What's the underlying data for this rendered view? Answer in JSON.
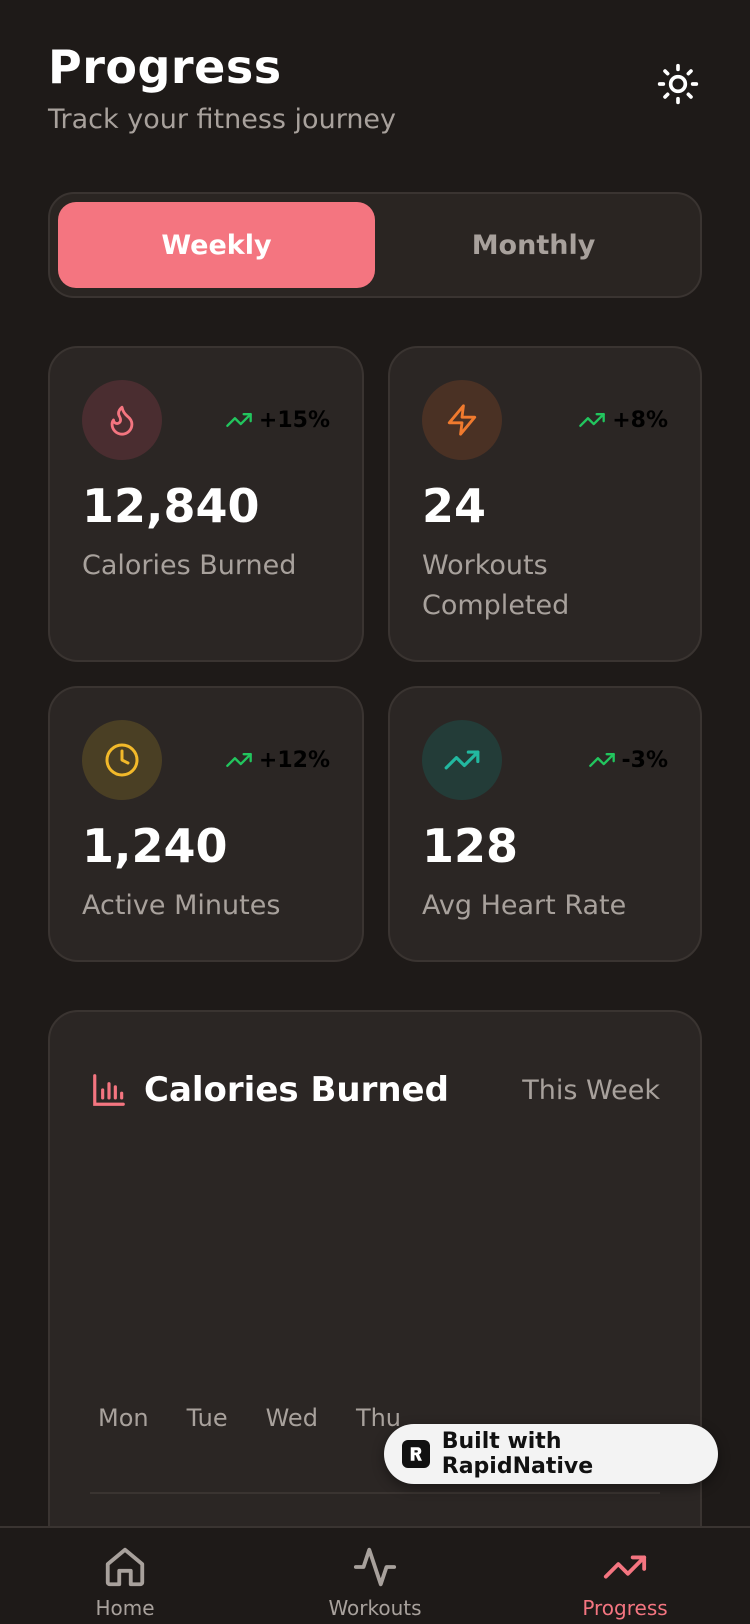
{
  "header": {
    "title": "Progress",
    "subtitle": "Track your fitness journey"
  },
  "segment": {
    "weekly": "Weekly",
    "monthly": "Monthly",
    "selected": "Weekly"
  },
  "stats": [
    {
      "icon": "flame-icon",
      "trend": "+15%",
      "value": "12,840",
      "label": "Calories Burned",
      "accent": "#f47580",
      "bg": "#4a2d30"
    },
    {
      "icon": "lightning-icon",
      "trend": "+8%",
      "value": "24",
      "label": "Workouts Completed",
      "accent": "#f07a2e",
      "bg": "#4a3124"
    },
    {
      "icon": "clock-icon",
      "trend": "+12%",
      "value": "1,240",
      "label": "Active Minutes",
      "accent": "#f2b92a",
      "bg": "#4a3f24"
    },
    {
      "icon": "trending-up-icon",
      "trend": "-3%",
      "value": "128",
      "label": "Avg Heart Rate",
      "accent": "#22b8a0",
      "bg": "#233c38"
    }
  ],
  "chart": {
    "title": "Calories Burned",
    "period": "This Week",
    "days": [
      "Mon",
      "Tue",
      "Wed",
      "Thu"
    ]
  },
  "badge": {
    "text": "Built with RapidNative"
  },
  "tabs": [
    {
      "label": "Home",
      "icon": "home-icon"
    },
    {
      "label": "Workouts",
      "icon": "activity-icon"
    },
    {
      "label": "Progress",
      "icon": "trending-up-icon"
    }
  ],
  "colors": {
    "background": "#1e1a18",
    "card": "#2b2624",
    "accent": "#f47580",
    "trend_green": "#22c55e"
  }
}
